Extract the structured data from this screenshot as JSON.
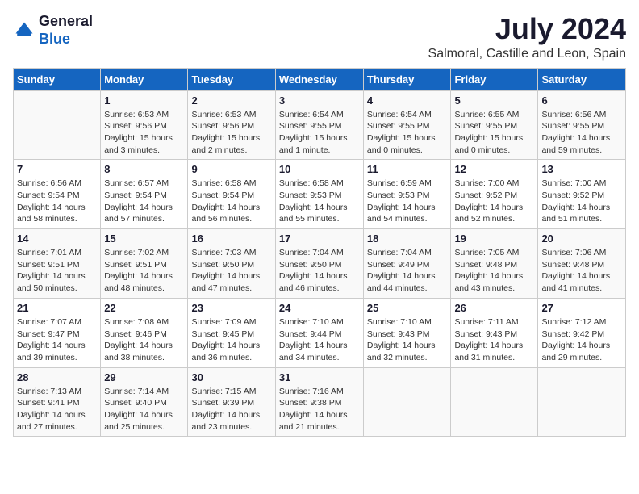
{
  "header": {
    "logo_line1": "General",
    "logo_line2": "Blue",
    "month": "July 2024",
    "location": "Salmoral, Castille and Leon, Spain"
  },
  "weekdays": [
    "Sunday",
    "Monday",
    "Tuesday",
    "Wednesday",
    "Thursday",
    "Friday",
    "Saturday"
  ],
  "weeks": [
    [
      {
        "day": "",
        "info": ""
      },
      {
        "day": "1",
        "info": "Sunrise: 6:53 AM\nSunset: 9:56 PM\nDaylight: 15 hours\nand 3 minutes."
      },
      {
        "day": "2",
        "info": "Sunrise: 6:53 AM\nSunset: 9:56 PM\nDaylight: 15 hours\nand 2 minutes."
      },
      {
        "day": "3",
        "info": "Sunrise: 6:54 AM\nSunset: 9:55 PM\nDaylight: 15 hours\nand 1 minute."
      },
      {
        "day": "4",
        "info": "Sunrise: 6:54 AM\nSunset: 9:55 PM\nDaylight: 15 hours\nand 0 minutes."
      },
      {
        "day": "5",
        "info": "Sunrise: 6:55 AM\nSunset: 9:55 PM\nDaylight: 15 hours\nand 0 minutes."
      },
      {
        "day": "6",
        "info": "Sunrise: 6:56 AM\nSunset: 9:55 PM\nDaylight: 14 hours\nand 59 minutes."
      }
    ],
    [
      {
        "day": "7",
        "info": "Sunrise: 6:56 AM\nSunset: 9:54 PM\nDaylight: 14 hours\nand 58 minutes."
      },
      {
        "day": "8",
        "info": "Sunrise: 6:57 AM\nSunset: 9:54 PM\nDaylight: 14 hours\nand 57 minutes."
      },
      {
        "day": "9",
        "info": "Sunrise: 6:58 AM\nSunset: 9:54 PM\nDaylight: 14 hours\nand 56 minutes."
      },
      {
        "day": "10",
        "info": "Sunrise: 6:58 AM\nSunset: 9:53 PM\nDaylight: 14 hours\nand 55 minutes."
      },
      {
        "day": "11",
        "info": "Sunrise: 6:59 AM\nSunset: 9:53 PM\nDaylight: 14 hours\nand 54 minutes."
      },
      {
        "day": "12",
        "info": "Sunrise: 7:00 AM\nSunset: 9:52 PM\nDaylight: 14 hours\nand 52 minutes."
      },
      {
        "day": "13",
        "info": "Sunrise: 7:00 AM\nSunset: 9:52 PM\nDaylight: 14 hours\nand 51 minutes."
      }
    ],
    [
      {
        "day": "14",
        "info": "Sunrise: 7:01 AM\nSunset: 9:51 PM\nDaylight: 14 hours\nand 50 minutes."
      },
      {
        "day": "15",
        "info": "Sunrise: 7:02 AM\nSunset: 9:51 PM\nDaylight: 14 hours\nand 48 minutes."
      },
      {
        "day": "16",
        "info": "Sunrise: 7:03 AM\nSunset: 9:50 PM\nDaylight: 14 hours\nand 47 minutes."
      },
      {
        "day": "17",
        "info": "Sunrise: 7:04 AM\nSunset: 9:50 PM\nDaylight: 14 hours\nand 46 minutes."
      },
      {
        "day": "18",
        "info": "Sunrise: 7:04 AM\nSunset: 9:49 PM\nDaylight: 14 hours\nand 44 minutes."
      },
      {
        "day": "19",
        "info": "Sunrise: 7:05 AM\nSunset: 9:48 PM\nDaylight: 14 hours\nand 43 minutes."
      },
      {
        "day": "20",
        "info": "Sunrise: 7:06 AM\nSunset: 9:48 PM\nDaylight: 14 hours\nand 41 minutes."
      }
    ],
    [
      {
        "day": "21",
        "info": "Sunrise: 7:07 AM\nSunset: 9:47 PM\nDaylight: 14 hours\nand 39 minutes."
      },
      {
        "day": "22",
        "info": "Sunrise: 7:08 AM\nSunset: 9:46 PM\nDaylight: 14 hours\nand 38 minutes."
      },
      {
        "day": "23",
        "info": "Sunrise: 7:09 AM\nSunset: 9:45 PM\nDaylight: 14 hours\nand 36 minutes."
      },
      {
        "day": "24",
        "info": "Sunrise: 7:10 AM\nSunset: 9:44 PM\nDaylight: 14 hours\nand 34 minutes."
      },
      {
        "day": "25",
        "info": "Sunrise: 7:10 AM\nSunset: 9:43 PM\nDaylight: 14 hours\nand 32 minutes."
      },
      {
        "day": "26",
        "info": "Sunrise: 7:11 AM\nSunset: 9:43 PM\nDaylight: 14 hours\nand 31 minutes."
      },
      {
        "day": "27",
        "info": "Sunrise: 7:12 AM\nSunset: 9:42 PM\nDaylight: 14 hours\nand 29 minutes."
      }
    ],
    [
      {
        "day": "28",
        "info": "Sunrise: 7:13 AM\nSunset: 9:41 PM\nDaylight: 14 hours\nand 27 minutes."
      },
      {
        "day": "29",
        "info": "Sunrise: 7:14 AM\nSunset: 9:40 PM\nDaylight: 14 hours\nand 25 minutes."
      },
      {
        "day": "30",
        "info": "Sunrise: 7:15 AM\nSunset: 9:39 PM\nDaylight: 14 hours\nand 23 minutes."
      },
      {
        "day": "31",
        "info": "Sunrise: 7:16 AM\nSunset: 9:38 PM\nDaylight: 14 hours\nand 21 minutes."
      },
      {
        "day": "",
        "info": ""
      },
      {
        "day": "",
        "info": ""
      },
      {
        "day": "",
        "info": ""
      }
    ]
  ]
}
